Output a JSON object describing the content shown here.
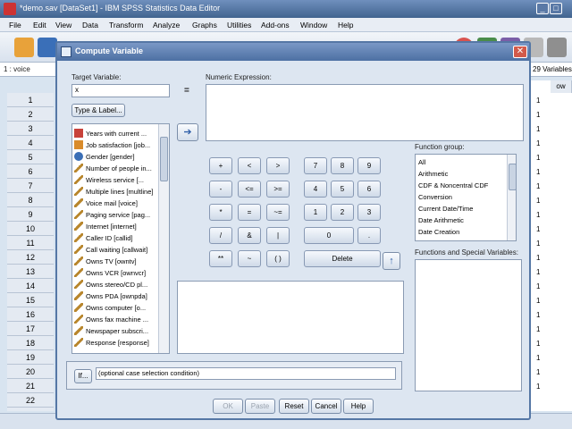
{
  "window": {
    "title": "*demo.sav [DataSet1] - IBM SPSS Statistics Data Editor",
    "min": "_",
    "max": "□",
    "close": "✕"
  },
  "menu": [
    "File",
    "Edit",
    "View",
    "Data",
    "Transform",
    "Analyze",
    "Graphs",
    "Utilities",
    "Add-ons",
    "Window",
    "Help"
  ],
  "cellbar": {
    "ref": "1 : voice",
    "visible": "29 Variables"
  },
  "grid": {
    "rows": [
      "1",
      "2",
      "3",
      "4",
      "5",
      "6",
      "7",
      "8",
      "9",
      "10",
      "11",
      "12",
      "13",
      "14",
      "15",
      "16",
      "17",
      "18",
      "19",
      "20",
      "21",
      "22"
    ],
    "right_col_header": "ow",
    "right_col_values": [
      "1",
      "1",
      "1",
      "1",
      "1",
      "1",
      "1",
      "1",
      "1",
      "1",
      "1",
      "1",
      "1",
      "1",
      "1",
      "1",
      "1",
      "1",
      "1",
      "1",
      "1"
    ]
  },
  "dialog": {
    "title": "Compute Variable",
    "close": "✕",
    "target_label": "Target Variable:",
    "target_value": "x",
    "equals": "=",
    "numeric_label": "Numeric Expression:",
    "type_label_button": "Type & Label...",
    "variables": [
      {
        "name": "Years with current ...",
        "icon": "scale-icon"
      },
      {
        "name": "Job satisfaction [job...",
        "icon": "ordinal-icon"
      },
      {
        "name": "Gender [gender]",
        "icon": "nominal-icon"
      },
      {
        "name": "Number of people in...",
        "icon": "pencil-icon"
      },
      {
        "name": "Wireless service [...",
        "icon": "pencil-icon"
      },
      {
        "name": "Multiple lines [multline]",
        "icon": "pencil-icon"
      },
      {
        "name": "Voice mail [voice]",
        "icon": "pencil-icon"
      },
      {
        "name": "Paging service [pag...",
        "icon": "pencil-icon"
      },
      {
        "name": "Internet [internet]",
        "icon": "pencil-icon"
      },
      {
        "name": "Caller ID [callid]",
        "icon": "pencil-icon"
      },
      {
        "name": "Call waiting [callwait]",
        "icon": "pencil-icon"
      },
      {
        "name": "Owns TV [owntv]",
        "icon": "pencil-icon"
      },
      {
        "name": "Owns VCR [ownvcr]",
        "icon": "pencil-icon"
      },
      {
        "name": "Owns stereo/CD pl...",
        "icon": "pencil-icon"
      },
      {
        "name": "Owns PDA [ownpda]",
        "icon": "pencil-icon"
      },
      {
        "name": "Owns computer [o...",
        "icon": "pencil-icon"
      },
      {
        "name": "Owns fax machine ...",
        "icon": "pencil-icon"
      },
      {
        "name": "Newspaper subscri...",
        "icon": "pencil-icon"
      },
      {
        "name": "Response [response]",
        "icon": "pencil-icon"
      }
    ],
    "keypad": {
      "row1": [
        "+",
        "<",
        ">",
        "7",
        "8",
        "9"
      ],
      "row2": [
        "-",
        "<=",
        ">=",
        "4",
        "5",
        "6"
      ],
      "row3": [
        "*",
        "=",
        "~=",
        "1",
        "2",
        "3"
      ],
      "row4": [
        "/",
        "&",
        "|",
        "0",
        "."
      ],
      "row5": [
        "**",
        "~",
        "( )",
        "Delete"
      ]
    },
    "function_group_label": "Function group:",
    "function_groups": [
      "All",
      "Arithmetic",
      "CDF & Noncentral CDF",
      "Conversion",
      "Current Date/Time",
      "Date Arithmetic",
      "Date Creation"
    ],
    "functions_label": "Functions and Special Variables:",
    "if_button": "If...",
    "if_text": "(optional case selection condition)",
    "buttons": {
      "ok": "OK",
      "paste": "Paste",
      "reset": "Reset",
      "cancel": "Cancel",
      "help": "Help"
    }
  }
}
